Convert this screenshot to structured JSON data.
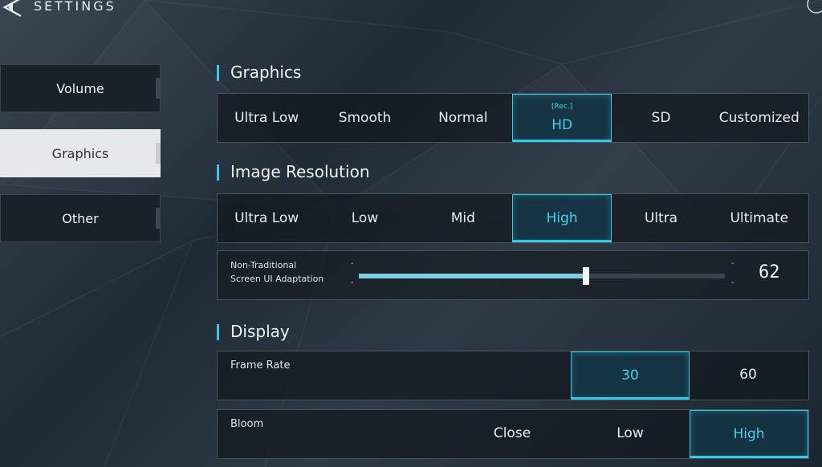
{
  "header": {
    "title": "SETTINGS",
    "back_icon": "back-triangle-icon"
  },
  "sidebar": {
    "items": [
      {
        "label": "Volume",
        "active": false
      },
      {
        "label": "Graphics",
        "active": true
      },
      {
        "label": "Other",
        "active": false
      }
    ]
  },
  "graphics": {
    "title": "Graphics",
    "options": [
      "Ultra Low",
      "Smooth",
      "Normal",
      "HD",
      "SD",
      "Customized"
    ],
    "selected": "HD",
    "recommended_tag": "[Rec.]"
  },
  "resolution": {
    "title": "Image Resolution",
    "options": [
      "Ultra Low",
      "Low",
      "Mid",
      "High",
      "Ultra",
      "Ultimate"
    ],
    "selected": "High"
  },
  "ui_adaptation": {
    "label_line1": "Non-Traditional",
    "label_line2": "Screen UI Adaptation",
    "value": "62",
    "fraction": 0.62,
    "dash": "-"
  },
  "display": {
    "title": "Display",
    "frame_rate": {
      "label": "Frame Rate",
      "options": [
        "30",
        "60"
      ],
      "selected": "30"
    },
    "bloom": {
      "label": "Bloom",
      "options": [
        "Close",
        "Low",
        "High"
      ],
      "selected": "High"
    }
  },
  "colors": {
    "accent": "#38c7e8",
    "panel": "#12181e"
  }
}
